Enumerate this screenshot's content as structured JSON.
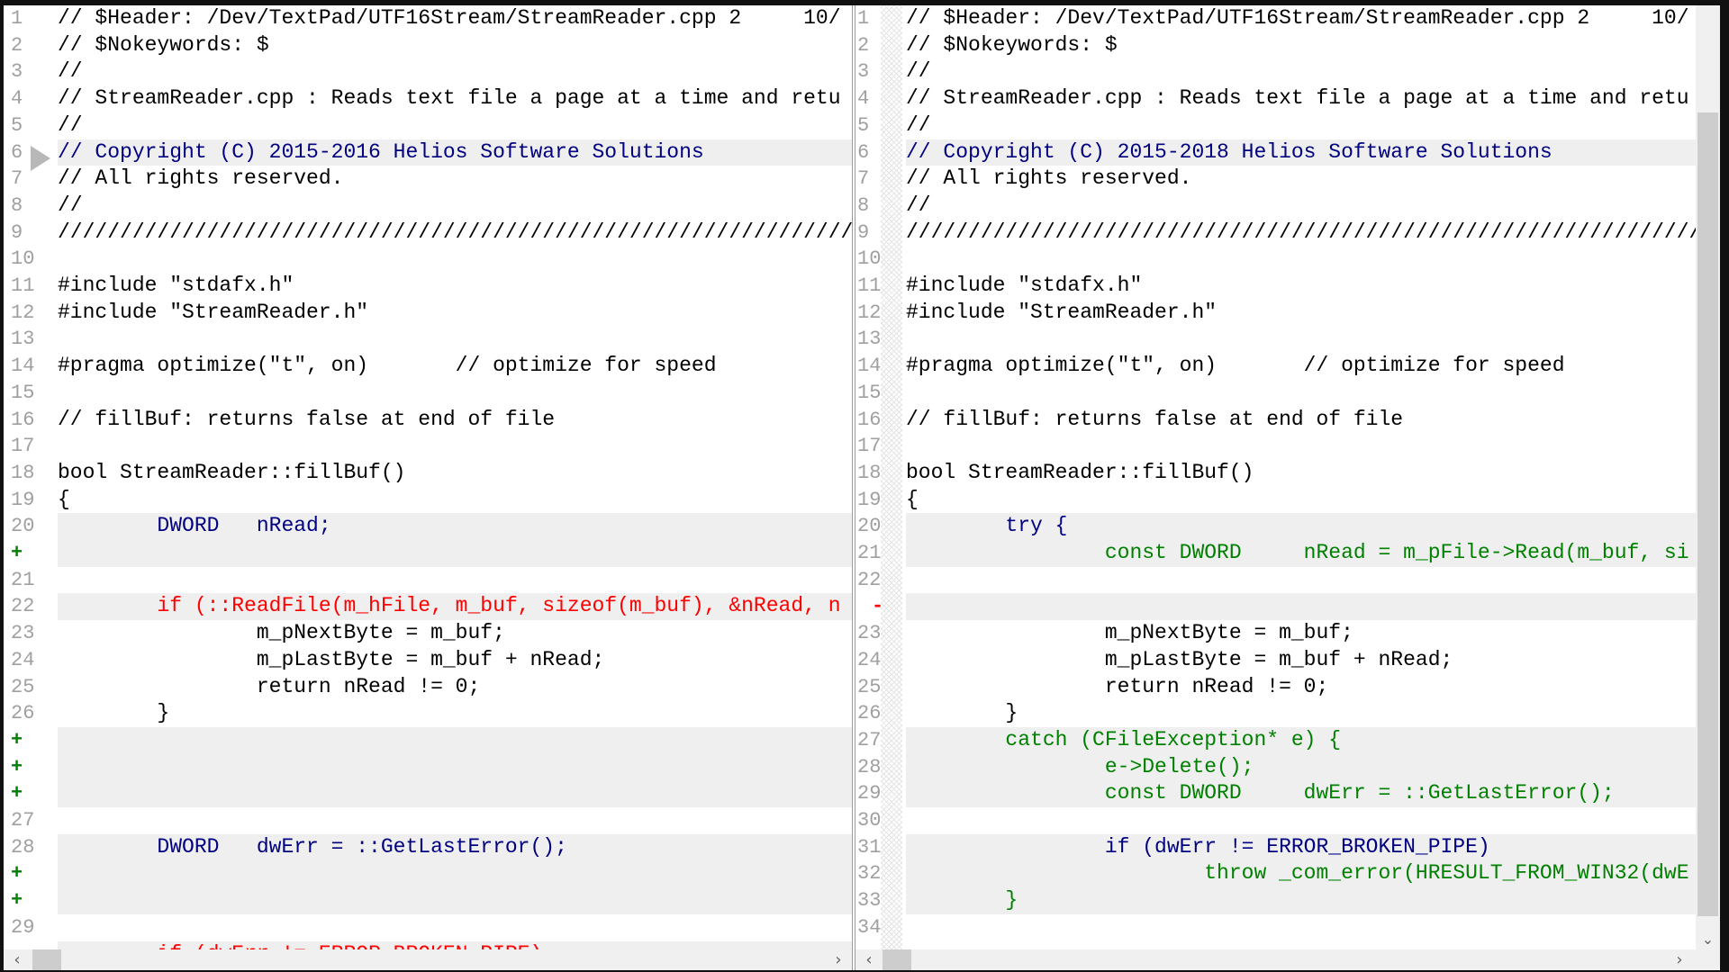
{
  "colors": {
    "changed": "#000080",
    "added": "#008000",
    "deleted": "#ff0000",
    "normal": "#000000",
    "highlight": "#efefef",
    "line_number": "#a0a0a0"
  },
  "left_pane": {
    "rows": [
      {
        "n": "1",
        "t": "// $Header: /Dev/TextPad/UTF16Stream/StreamReader.cpp 2     10/",
        "k": "normal"
      },
      {
        "n": "2",
        "t": "// $Nokeywords: $",
        "k": "normal"
      },
      {
        "n": "3",
        "t": "//",
        "k": "normal"
      },
      {
        "n": "4",
        "t": "// StreamReader.cpp : Reads text file a page at a time and retu",
        "k": "normal"
      },
      {
        "n": "5",
        "t": "//",
        "k": "normal"
      },
      {
        "n": "6",
        "t": "// Copyright (C) 2015-2016 Helios Software Solutions",
        "k": "changed"
      },
      {
        "n": "7",
        "t": "// All rights reserved.",
        "k": "normal"
      },
      {
        "n": "8",
        "t": "//",
        "k": "normal"
      },
      {
        "n": "9",
        "t": "//////////////////////////////////////////////////////////////////",
        "k": "normal"
      },
      {
        "n": "10",
        "t": "",
        "k": "normal"
      },
      {
        "n": "11",
        "t": "#include \"stdafx.h\"",
        "k": "normal"
      },
      {
        "n": "12",
        "t": "#include \"StreamReader.h\"",
        "k": "normal"
      },
      {
        "n": "13",
        "t": "",
        "k": "normal"
      },
      {
        "n": "14",
        "t": "#pragma optimize(\"t\", on)       // optimize for speed",
        "k": "normal"
      },
      {
        "n": "15",
        "t": "",
        "k": "normal"
      },
      {
        "n": "16",
        "t": "// fillBuf: returns false at end of file",
        "k": "normal"
      },
      {
        "n": "17",
        "t": "",
        "k": "normal"
      },
      {
        "n": "18",
        "t": "bool StreamReader::fillBuf()",
        "k": "normal"
      },
      {
        "n": "19",
        "t": "{",
        "k": "normal"
      },
      {
        "n": "20",
        "t": "        DWORD   nRead;",
        "k": "changed"
      },
      {
        "n": "+",
        "t": "",
        "k": "placeholder"
      },
      {
        "n": "21",
        "t": "",
        "k": "normal"
      },
      {
        "n": "22",
        "t": "        if (::ReadFile(m_hFile, m_buf, sizeof(m_buf), &nRead, n",
        "k": "deleted"
      },
      {
        "n": "23",
        "t": "                m_pNextByte = m_buf;",
        "k": "normal"
      },
      {
        "n": "24",
        "t": "                m_pLastByte = m_buf + nRead;",
        "k": "normal"
      },
      {
        "n": "25",
        "t": "                return nRead != 0;",
        "k": "normal"
      },
      {
        "n": "26",
        "t": "        }",
        "k": "normal"
      },
      {
        "n": "+",
        "t": "",
        "k": "placeholder"
      },
      {
        "n": "+",
        "t": "",
        "k": "placeholder"
      },
      {
        "n": "+",
        "t": "",
        "k": "placeholder"
      },
      {
        "n": "27",
        "t": "",
        "k": "normal"
      },
      {
        "n": "28",
        "t": "        DWORD   dwErr = ::GetLastError();",
        "k": "changed"
      },
      {
        "n": "+",
        "t": "",
        "k": "placeholder"
      },
      {
        "n": "+",
        "t": "",
        "k": "placeholder"
      },
      {
        "n": "29",
        "t": "",
        "k": "normal"
      },
      {
        "n": "",
        "t": "        if (dwErr != ERROR_BROKEN_PIPE)",
        "k": "deleted"
      }
    ]
  },
  "right_pane": {
    "rows": [
      {
        "n": "1",
        "t": "// $Header: /Dev/TextPad/UTF16Stream/StreamReader.cpp 2     10/",
        "k": "normal"
      },
      {
        "n": "2",
        "t": "// $Nokeywords: $",
        "k": "normal"
      },
      {
        "n": "3",
        "t": "//",
        "k": "normal"
      },
      {
        "n": "4",
        "t": "// StreamReader.cpp : Reads text file a page at a time and retu",
        "k": "normal"
      },
      {
        "n": "5",
        "t": "//",
        "k": "normal"
      },
      {
        "n": "6",
        "t": "// Copyright (C) 2015-2018 Helios Software Solutions",
        "k": "changed"
      },
      {
        "n": "7",
        "t": "// All rights reserved.",
        "k": "normal"
      },
      {
        "n": "8",
        "t": "//",
        "k": "normal"
      },
      {
        "n": "9",
        "t": "//////////////////////////////////////////////////////////////////",
        "k": "normal"
      },
      {
        "n": "10",
        "t": "",
        "k": "normal"
      },
      {
        "n": "11",
        "t": "#include \"stdafx.h\"",
        "k": "normal"
      },
      {
        "n": "12",
        "t": "#include \"StreamReader.h\"",
        "k": "normal"
      },
      {
        "n": "13",
        "t": "",
        "k": "normal"
      },
      {
        "n": "14",
        "t": "#pragma optimize(\"t\", on)       // optimize for speed",
        "k": "normal"
      },
      {
        "n": "15",
        "t": "",
        "k": "normal"
      },
      {
        "n": "16",
        "t": "// fillBuf: returns false at end of file",
        "k": "normal"
      },
      {
        "n": "17",
        "t": "",
        "k": "normal"
      },
      {
        "n": "18",
        "t": "bool StreamReader::fillBuf()",
        "k": "normal"
      },
      {
        "n": "19",
        "t": "{",
        "k": "normal"
      },
      {
        "n": "20",
        "t": "        try {",
        "k": "changed"
      },
      {
        "n": "21",
        "t": "                const DWORD     nRead = m_pFile->Read(m_buf, si",
        "k": "added"
      },
      {
        "n": "22",
        "t": "",
        "k": "normal"
      },
      {
        "n": "-",
        "t": "",
        "k": "placeholder"
      },
      {
        "n": "23",
        "t": "                m_pNextByte = m_buf;",
        "k": "normal"
      },
      {
        "n": "24",
        "t": "                m_pLastByte = m_buf + nRead;",
        "k": "normal"
      },
      {
        "n": "25",
        "t": "                return nRead != 0;",
        "k": "normal"
      },
      {
        "n": "26",
        "t": "        }",
        "k": "normal"
      },
      {
        "n": "27",
        "t": "        catch (CFileException* e) {",
        "k": "added"
      },
      {
        "n": "28",
        "t": "                e->Delete();",
        "k": "added"
      },
      {
        "n": "29",
        "t": "                const DWORD     dwErr = ::GetLastError();",
        "k": "added"
      },
      {
        "n": "30",
        "t": "",
        "k": "normal"
      },
      {
        "n": "31",
        "t": "                if (dwErr != ERROR_BROKEN_PIPE)",
        "k": "changed"
      },
      {
        "n": "32",
        "t": "                        throw _com_error(HRESULT_FROM_WIN32(dwE",
        "k": "added"
      },
      {
        "n": "33",
        "t": "        }",
        "k": "added"
      },
      {
        "n": "34",
        "t": "",
        "k": "normal"
      }
    ]
  },
  "scrollbars": {
    "left_arrow": "‹",
    "right_arrow": "›",
    "down_arrow": "⌄"
  },
  "icons": {
    "current_diff_marker": "chevron-right-icon"
  }
}
